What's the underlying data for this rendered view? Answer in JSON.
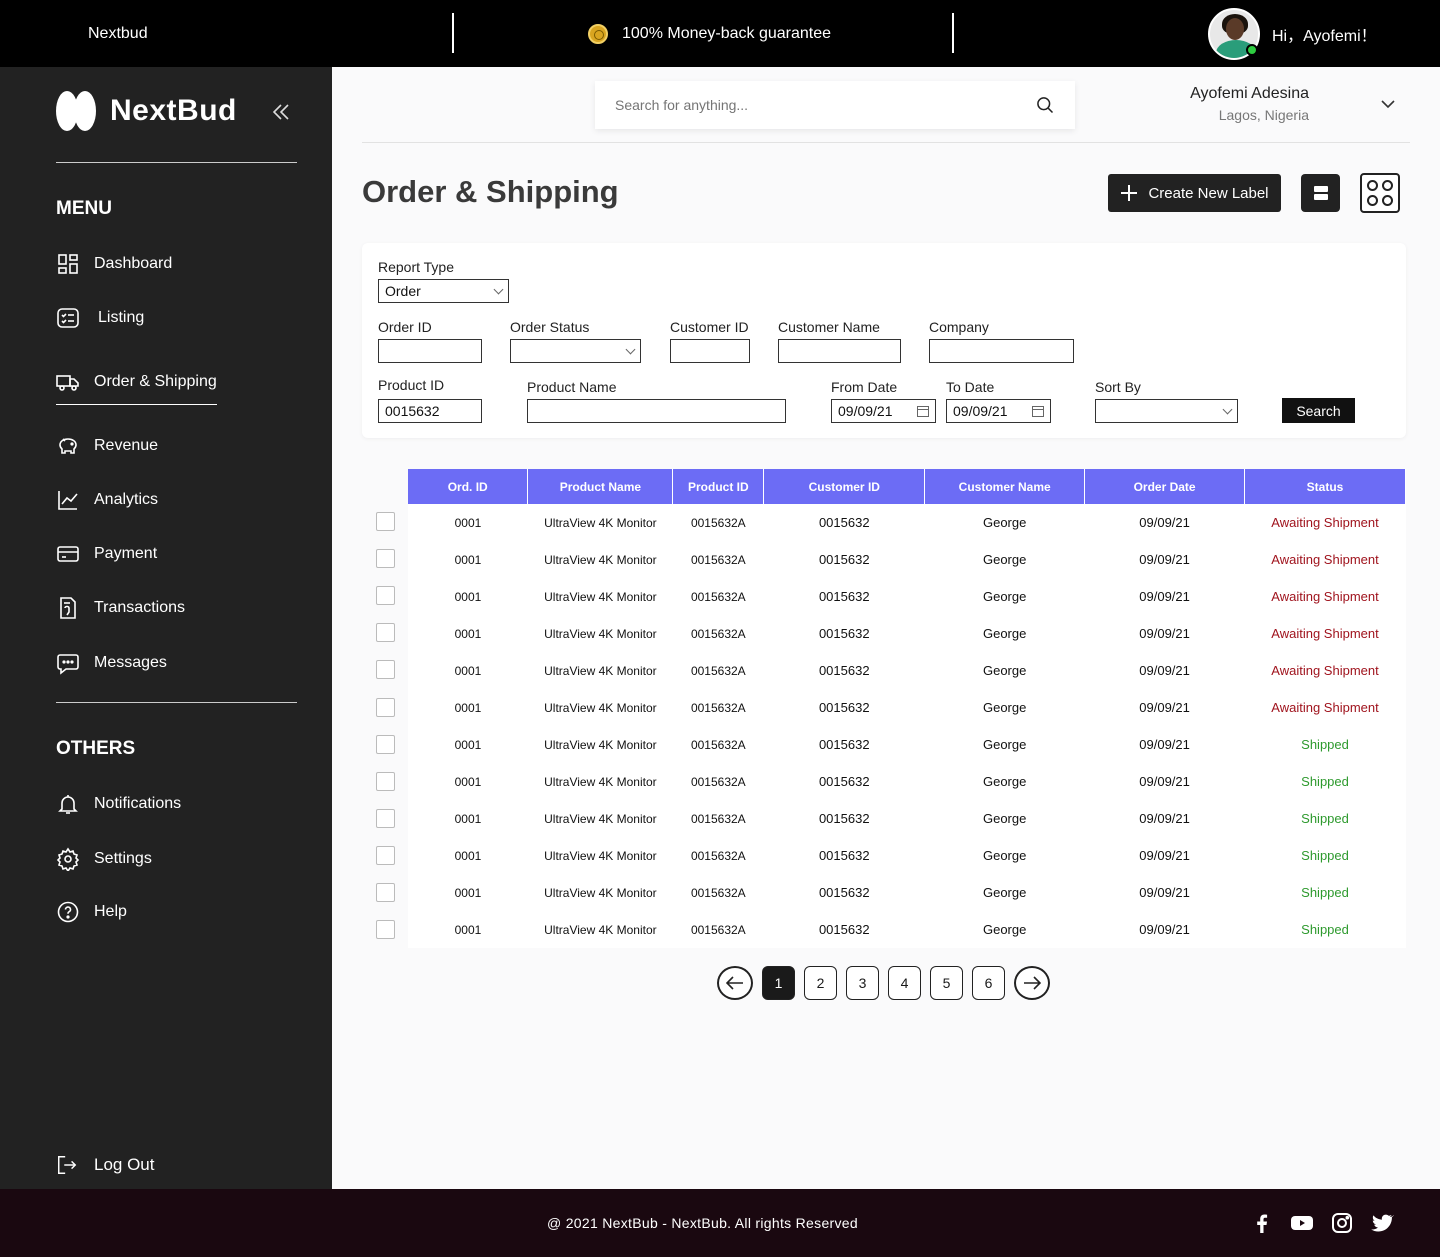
{
  "topbar": {
    "brand": "Nextbud",
    "promo": "100% Money-back guarantee",
    "greeting": "Hi，Ayofemi！"
  },
  "sidebar": {
    "logo": "NextBud",
    "collapse_icon": "double-chevron-left-icon",
    "menu_heading": "MENU",
    "menu_items": [
      {
        "label": "Dashboard",
        "icon": "dashboard-icon"
      },
      {
        "label": "Listing",
        "icon": "listing-icon"
      },
      {
        "label": "Order & Shipping",
        "icon": "truck-icon",
        "active": true
      },
      {
        "label": "Revenue",
        "icon": "piggy-bank-icon"
      },
      {
        "label": "Analytics",
        "icon": "analytics-icon"
      },
      {
        "label": "Payment",
        "icon": "card-icon"
      },
      {
        "label": "Transactions",
        "icon": "transactions-icon"
      },
      {
        "label": "Messages",
        "icon": "message-icon"
      }
    ],
    "others_heading": "OTHERS",
    "other_items": [
      {
        "label": "Notifications",
        "icon": "bell-icon"
      },
      {
        "label": "Settings",
        "icon": "gear-icon"
      },
      {
        "label": "Help",
        "icon": "help-icon"
      }
    ],
    "logout": "Log Out"
  },
  "header": {
    "search_placeholder": "Search for anything...",
    "user_name": "Ayofemi Adesina",
    "user_location": "Lagos, Nigeria"
  },
  "page": {
    "title": "Order & Shipping",
    "create_label": "Create New Label"
  },
  "filters": {
    "report_type_label": "Report Type",
    "report_type_value": "Order",
    "order_id_label": "Order ID",
    "order_status_label": "Order Status",
    "customer_id_label": "Customer ID",
    "customer_name_label": "Customer Name",
    "company_label": "Company",
    "product_id_label": "Product ID",
    "product_id_value": "0015632",
    "product_name_label": "Product Name",
    "from_date_label": "From Date",
    "from_date_value": "09/09/21",
    "to_date_label": "To Date",
    "to_date_value": "09/09/21",
    "sort_by_label": "Sort By",
    "search_button": "Search"
  },
  "table": {
    "columns": [
      "Ord. ID",
      "Product Name",
      "Product ID",
      "Customer ID",
      "Customer Name",
      "Order Date",
      "Status"
    ],
    "rows": [
      [
        "0001",
        "UltraView 4K Monitor",
        "0015632A",
        "0015632",
        "George",
        "09/09/21",
        "Awaiting Shipment"
      ],
      [
        "0001",
        "UltraView 4K Monitor",
        "0015632A",
        "0015632",
        "George",
        "09/09/21",
        "Awaiting Shipment"
      ],
      [
        "0001",
        "UltraView 4K Monitor",
        "0015632A",
        "0015632",
        "George",
        "09/09/21",
        "Awaiting Shipment"
      ],
      [
        "0001",
        "UltraView 4K Monitor",
        "0015632A",
        "0015632",
        "George",
        "09/09/21",
        "Awaiting Shipment"
      ],
      [
        "0001",
        "UltraView 4K Monitor",
        "0015632A",
        "0015632",
        "George",
        "09/09/21",
        "Awaiting Shipment"
      ],
      [
        "0001",
        "UltraView 4K Monitor",
        "0015632A",
        "0015632",
        "George",
        "09/09/21",
        "Awaiting Shipment"
      ],
      [
        "0001",
        "UltraView 4K Monitor",
        "0015632A",
        "0015632",
        "George",
        "09/09/21",
        "Shipped"
      ],
      [
        "0001",
        "UltraView 4K Monitor",
        "0015632A",
        "0015632",
        "George",
        "09/09/21",
        "Shipped"
      ],
      [
        "0001",
        "UltraView 4K Monitor",
        "0015632A",
        "0015632",
        "George",
        "09/09/21",
        "Shipped"
      ],
      [
        "0001",
        "UltraView 4K Monitor",
        "0015632A",
        "0015632",
        "George",
        "09/09/21",
        "Shipped"
      ],
      [
        "0001",
        "UltraView 4K Monitor",
        "0015632A",
        "0015632",
        "George",
        "09/09/21",
        "Shipped"
      ],
      [
        "0001",
        "UltraView 4K Monitor",
        "0015632A",
        "0015632",
        "George",
        "09/09/21",
        "Shipped"
      ]
    ],
    "status_colors": {
      "Awaiting Shipment": "#a0141e",
      "Shipped": "#2e9a2e"
    },
    "header_color": "#6c6cf5"
  },
  "pagination": {
    "pages": [
      "1",
      "2",
      "3",
      "4",
      "5",
      "6"
    ],
    "current": "1"
  },
  "footer": {
    "copyright": "@ 2021 NextBub - NextBub. All rights Reserved",
    "socials": [
      "facebook-icon",
      "youtube-icon",
      "instagram-icon",
      "twitter-icon"
    ]
  }
}
